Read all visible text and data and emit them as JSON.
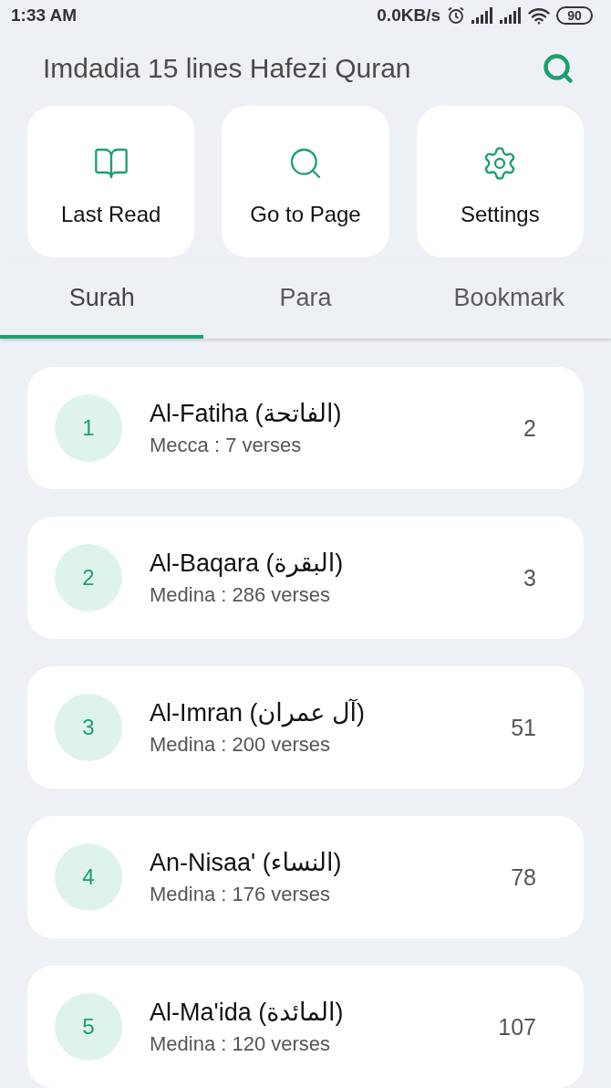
{
  "status_bar": {
    "time": "1:33 AM",
    "network_speed": "0.0KB/s",
    "battery": "90"
  },
  "app_bar": {
    "title": "Imdadia 15 lines Hafezi Quran"
  },
  "quick_actions": [
    {
      "kind": "book",
      "label": "Last Read"
    },
    {
      "kind": "search",
      "label": "Go to Page"
    },
    {
      "kind": "gear",
      "label": "Settings"
    }
  ],
  "tabs": [
    {
      "label": "Surah",
      "selected": true
    },
    {
      "label": "Para",
      "selected": false
    },
    {
      "label": "Bookmark",
      "selected": false
    }
  ],
  "surahs": [
    {
      "number": "1",
      "name": "Al-Fatiha (الفاتحة)",
      "details": "Mecca : 7 verses",
      "page": "2"
    },
    {
      "number": "2",
      "name": "Al-Baqara (البقرة)",
      "details": "Medina : 286 verses",
      "page": "3"
    },
    {
      "number": "3",
      "name": "Al-Imran (آل عمران)",
      "details": "Medina : 200 verses",
      "page": "51"
    },
    {
      "number": "4",
      "name": "An-Nisaa' (النساء)",
      "details": "Medina : 176 verses",
      "page": "78"
    },
    {
      "number": "5",
      "name": "Al-Ma'ida (المائدة)",
      "details": "Medina : 120 verses",
      "page": "107"
    }
  ]
}
